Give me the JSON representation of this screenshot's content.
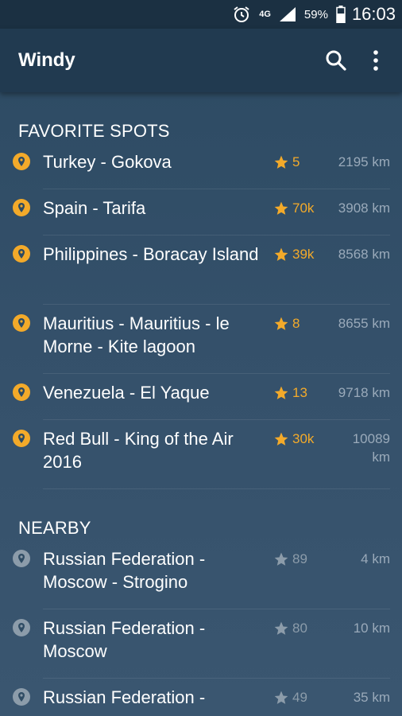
{
  "status_bar": {
    "network": "4G",
    "battery": "59%",
    "time": "16:03"
  },
  "app_bar": {
    "title": "Windy",
    "icons": [
      "search-icon",
      "more-vert-icon"
    ]
  },
  "colors": {
    "accent": "#f3aa2a",
    "muted": "#8c9caa",
    "background": "#2c4a62",
    "app_bar": "#213a50"
  },
  "favorites": {
    "header": "FAVORITE SPOTS",
    "items": [
      {
        "name": "Turkey - Gokova",
        "rating": "5",
        "distance": "2195 km"
      },
      {
        "name": "Spain - Tarifa",
        "rating": "70k",
        "distance": "3908 km"
      },
      {
        "name": "Philippines - Boracay Island",
        "rating": "39k",
        "distance": "8568 km"
      },
      {
        "name": "Mauritius - Mauritius - le Morne - Kite lagoon",
        "rating": "8",
        "distance": "8655 km"
      },
      {
        "name": "Venezuela - El Yaque",
        "rating": "13",
        "distance": "9718 km"
      },
      {
        "name": "Red Bull - King of the Air 2016",
        "rating": "30k",
        "distance": "10089 km"
      }
    ]
  },
  "nearby": {
    "header": "NEARBY",
    "items": [
      {
        "name": "Russian Federation - Moscow - Strogino",
        "rating": "89",
        "distance": "4 km"
      },
      {
        "name": "Russian Federation - Moscow",
        "rating": "80",
        "distance": "10 km"
      },
      {
        "name": "Russian Federation -",
        "rating": "49",
        "distance": "35 km"
      }
    ]
  }
}
